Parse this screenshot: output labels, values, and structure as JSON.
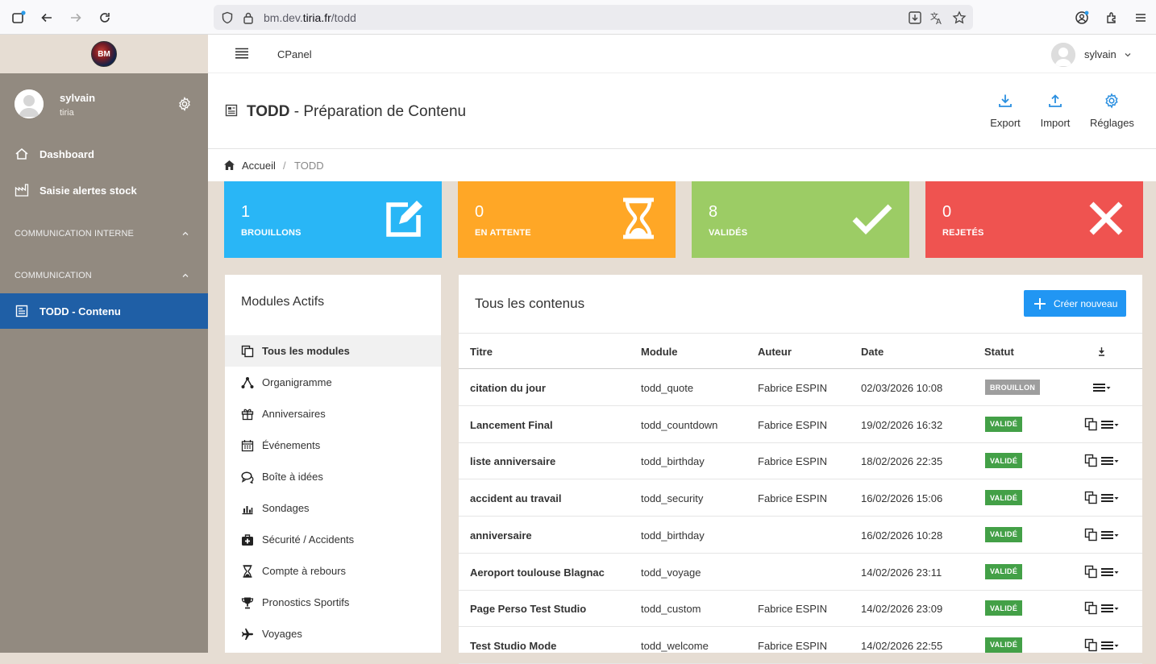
{
  "browser": {
    "url_prefix": "bm.dev.",
    "url_domain": "tiria.fr",
    "url_path": "/todd"
  },
  "sidebar": {
    "logo_text": "BM",
    "user_name": "sylvain",
    "user_org": "tiria",
    "items": [
      {
        "label": "Dashboard"
      },
      {
        "label": "Saisie alertes stock"
      }
    ],
    "sections": [
      {
        "label": "COMMUNICATION INTERNE"
      },
      {
        "label": "COMMUNICATION"
      }
    ],
    "active_item": "TODD - Contenu"
  },
  "topbar": {
    "cpanel": "CPanel",
    "user": "sylvain"
  },
  "header": {
    "title_bold": "TODD",
    "title_rest": " - Préparation de Contenu",
    "export": "Export",
    "import": "Import",
    "settings": "Réglages"
  },
  "breadcrumb": {
    "home": "Accueil",
    "sep": "/",
    "current": "TODD"
  },
  "stats": [
    {
      "value": "1",
      "label": "BROUILLONS",
      "color": "#29b6f6"
    },
    {
      "value": "0",
      "label": "EN ATTENTE",
      "color": "#ffa726"
    },
    {
      "value": "8",
      "label": "VALIDÉS",
      "color": "#9ccc65"
    },
    {
      "value": "0",
      "label": "REJETÉS",
      "color": "#ef5350"
    }
  ],
  "modules": {
    "title": "Modules Actifs",
    "items": [
      {
        "label": "Tous les modules",
        "icon": "copy-icon"
      },
      {
        "label": "Organigramme",
        "icon": "org-chart-icon"
      },
      {
        "label": "Anniversaires",
        "icon": "gift-icon"
      },
      {
        "label": "Événements",
        "icon": "calendar-icon"
      },
      {
        "label": "Boîte à idées",
        "icon": "comments-icon"
      },
      {
        "label": "Sondages",
        "icon": "bar-chart-icon"
      },
      {
        "label": "Sécurité / Accidents",
        "icon": "medkit-icon"
      },
      {
        "label": "Compte à rebours",
        "icon": "hourglass-icon"
      },
      {
        "label": "Pronostics Sportifs",
        "icon": "trophy-icon"
      },
      {
        "label": "Voyages",
        "icon": "plane-icon"
      }
    ]
  },
  "contents": {
    "title": "Tous les contenus",
    "new_button": "Créer nouveau",
    "columns": {
      "titre": "Titre",
      "module": "Module",
      "auteur": "Auteur",
      "date": "Date",
      "statut": "Statut"
    },
    "rows": [
      {
        "titre": "citation du jour",
        "module": "todd_quote",
        "auteur": "Fabrice ESPIN",
        "date": "02/03/2026 10:08",
        "statut": "BROUILLON",
        "duplicate": false
      },
      {
        "titre": "Lancement Final",
        "module": "todd_countdown",
        "auteur": "Fabrice ESPIN",
        "date": "19/02/2026 16:32",
        "statut": "VALIDÉ",
        "duplicate": true
      },
      {
        "titre": "liste anniversaire",
        "module": "todd_birthday",
        "auteur": "Fabrice ESPIN",
        "date": "18/02/2026 22:35",
        "statut": "VALIDÉ",
        "duplicate": true
      },
      {
        "titre": "accident au travail",
        "module": "todd_security",
        "auteur": "Fabrice ESPIN",
        "date": "16/02/2026 15:06",
        "statut": "VALIDÉ",
        "duplicate": true
      },
      {
        "titre": "anniversaire",
        "module": "todd_birthday",
        "auteur": "",
        "date": "16/02/2026 10:28",
        "statut": "VALIDÉ",
        "duplicate": true
      },
      {
        "titre": "Aeroport toulouse Blagnac",
        "module": "todd_voyage",
        "auteur": "",
        "date": "14/02/2026 23:11",
        "statut": "VALIDÉ",
        "duplicate": true
      },
      {
        "titre": "Page Perso Test Studio",
        "module": "todd_custom",
        "auteur": "Fabrice ESPIN",
        "date": "14/02/2026 23:09",
        "statut": "VALIDÉ",
        "duplicate": true
      },
      {
        "titre": "Test Studio Mode",
        "module": "todd_welcome",
        "auteur": "Fabrice ESPIN",
        "date": "14/02/2026 22:55",
        "statut": "VALIDÉ",
        "duplicate": true
      }
    ]
  },
  "colors": {
    "sidebar_bg": "#928a80",
    "active_blue": "#1f5fa6",
    "accent": "#2196f3",
    "valid_green": "#43a047",
    "draft_grey": "#9e9e9e"
  }
}
